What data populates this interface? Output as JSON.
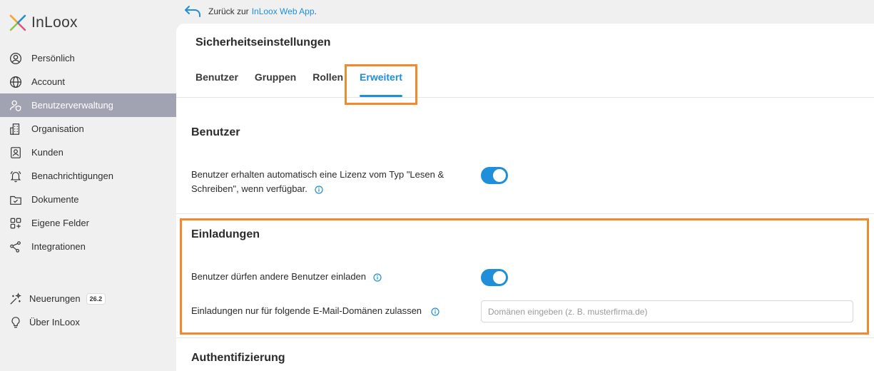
{
  "app": {
    "logo_text": "InLoox"
  },
  "back": {
    "prefix": "Zurück zur ",
    "link": "InLoox Web App",
    "suffix": "."
  },
  "sidebar": {
    "items": [
      {
        "label": "Persönlich",
        "icon": "user-circle-icon"
      },
      {
        "label": "Account",
        "icon": "globe-icon"
      },
      {
        "label": "Benutzerverwaltung",
        "icon": "user-shield-icon",
        "active": true
      },
      {
        "label": "Organisation",
        "icon": "building-icon"
      },
      {
        "label": "Kunden",
        "icon": "contact-card-icon"
      },
      {
        "label": "Benachrichtigungen",
        "icon": "bell-icon"
      },
      {
        "label": "Dokumente",
        "icon": "folder-check-icon"
      },
      {
        "label": "Eigene Felder",
        "icon": "grid-plus-icon"
      },
      {
        "label": "Integrationen",
        "icon": "share-nodes-icon"
      }
    ],
    "bottom": [
      {
        "label": "Neuerungen",
        "badge": "26.2",
        "icon": "sparkle-icon"
      },
      {
        "label": "Über InLoox",
        "icon": "lightbulb-icon"
      }
    ]
  },
  "main": {
    "title": "Sicherheitseinstellungen",
    "tabs": [
      {
        "label": "Benutzer"
      },
      {
        "label": "Gruppen"
      },
      {
        "label": "Rollen"
      },
      {
        "label": "Erweitert",
        "active": true
      }
    ],
    "sections": {
      "benutzer": {
        "title": "Benutzer",
        "auto_license_label": "Benutzer erhalten automatisch eine Lizenz vom Typ \"Lesen & Schreiben\", wenn verfügbar.",
        "auto_license_enabled": true
      },
      "einladungen": {
        "title": "Einladungen",
        "invite_label": "Benutzer dürfen andere Benutzer einladen",
        "invite_enabled": true,
        "domains_label": "Einladungen nur für folgende E-Mail-Domänen zulassen",
        "domains_value": "",
        "domains_placeholder": "Domänen eingeben (z. B. musterfirma.de)"
      },
      "auth": {
        "title": "Authentifizierung"
      }
    }
  },
  "colors": {
    "accent": "#1e8fd8",
    "highlight": "#f08a2e",
    "sidebar_active": "#a1a3b2"
  }
}
